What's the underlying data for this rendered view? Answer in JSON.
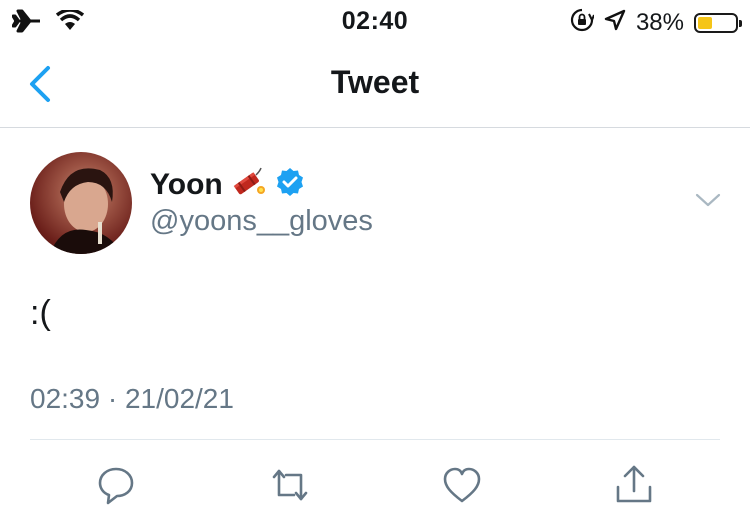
{
  "status_bar": {
    "time": "02:40",
    "battery_percent": "38%",
    "battery_level": 0.38,
    "icons": [
      "airplane-icon",
      "wifi-icon",
      "orientation-lock-icon",
      "location-icon",
      "battery-icon"
    ]
  },
  "nav": {
    "title": "Tweet",
    "back_icon": "chevron-left-icon"
  },
  "tweet": {
    "display_name": "Yoon",
    "name_emoji": "firecracker",
    "verified": true,
    "username": "@yoons__gloves",
    "text": ":(",
    "timestamp": "02:39 · 21/02/21"
  },
  "actions": [
    "reply-icon",
    "retweet-icon",
    "like-icon",
    "share-icon"
  ],
  "colors": {
    "accent": "#1da1f2",
    "secondary_text": "#657786",
    "divider": "#e1e8ed",
    "battery": "#f5c518"
  }
}
